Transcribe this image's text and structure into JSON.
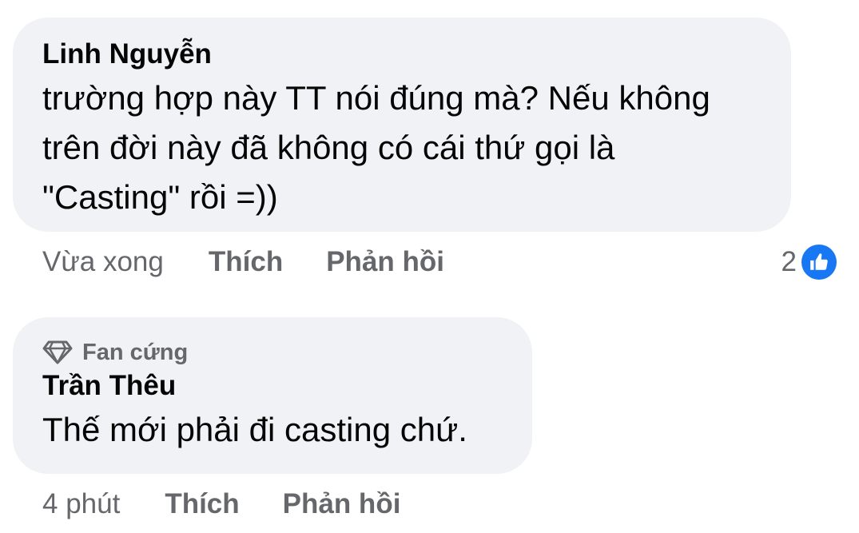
{
  "comments": [
    {
      "author": "Linh Nguyễn",
      "text": "trường hợp này TT nói đúng mà? Nếu không\ntrên đời này đã không có cái thứ gọi là\n\"Casting\" rồi =))",
      "time": "Vừa xong",
      "like_label": "Thích",
      "reply_label": "Phản hồi",
      "reaction_count": "2",
      "reaction_icon": "like-icon"
    },
    {
      "badge": "Fan cứng",
      "badge_icon": "diamond-icon",
      "author": "Trần Thêu",
      "text": "Thế mới phải đi casting chứ.",
      "time": "4 phút",
      "like_label": "Thích",
      "reply_label": "Phản hồi"
    }
  ],
  "colors": {
    "bubble": "#f0f2f5",
    "secondary_text": "#65676b",
    "like_blue": "#1877f2"
  }
}
